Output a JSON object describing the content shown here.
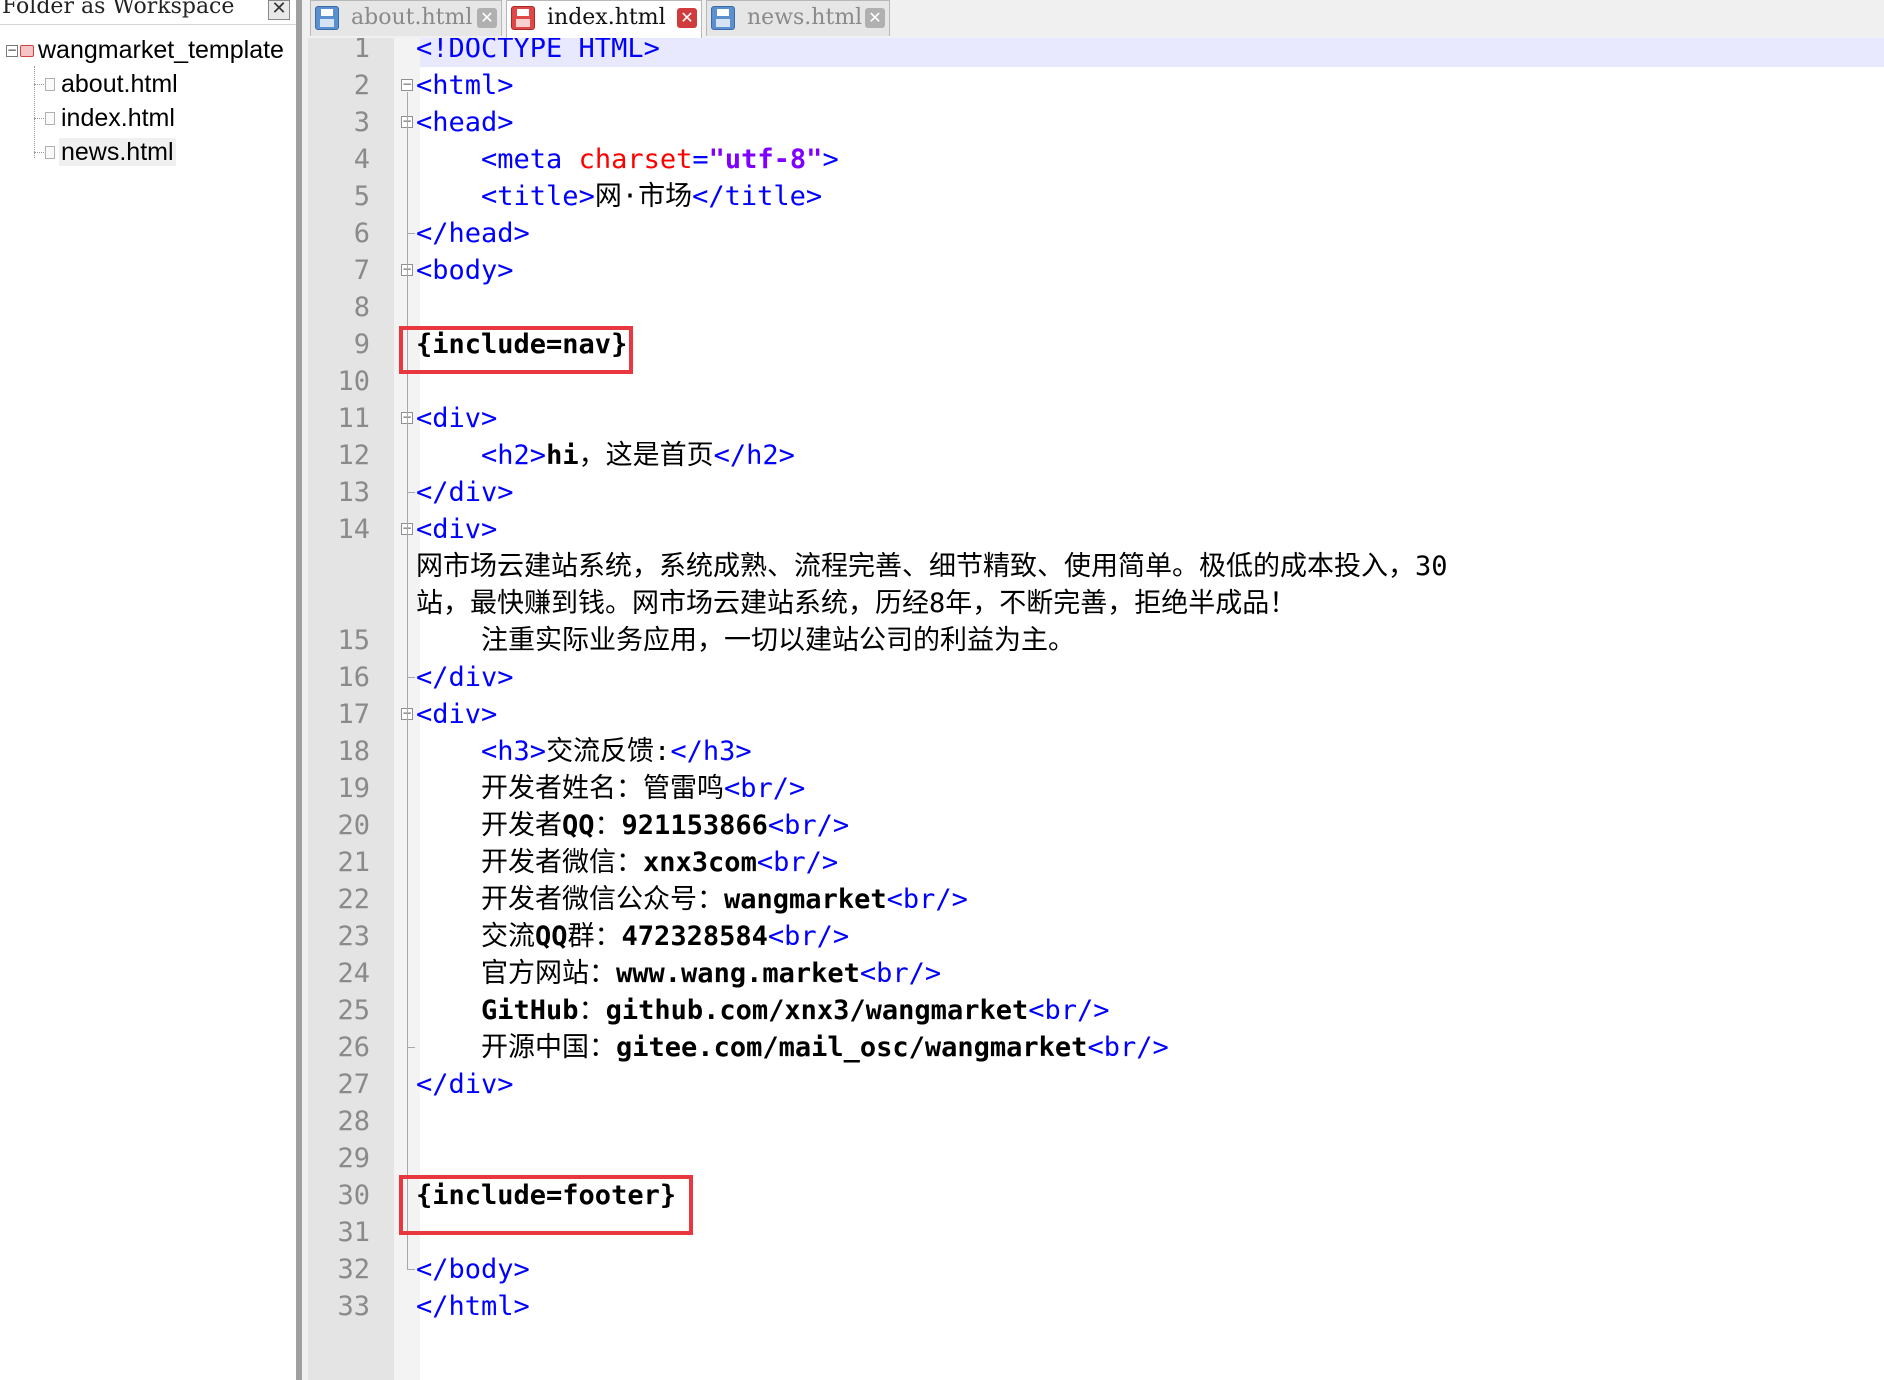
{
  "colors": {
    "tag": "#0000ff",
    "attribute": "#ff0000",
    "string": "#8000ff",
    "text": "#000000",
    "highlight_box": "#e8373f",
    "current_line": "#e8e8ff"
  },
  "sidebar": {
    "title": "Folder as Workspace",
    "close_icon": "close-icon",
    "root": {
      "label": "wangmarket_template",
      "toggle": "−"
    },
    "files": [
      {
        "label": "about.html"
      },
      {
        "label": "index.html"
      },
      {
        "label": "news.html",
        "selected": true
      }
    ]
  },
  "tabs": [
    {
      "label": "about.html",
      "icon": "save-icon-blue",
      "active": false
    },
    {
      "label": "index.html",
      "icon": "save-icon-red",
      "active": true
    },
    {
      "label": "news.html",
      "icon": "save-icon-blue",
      "active": false
    }
  ],
  "editor": {
    "lines": [
      {
        "n": "1",
        "tokens": [
          [
            "tag",
            "<!DOCTYPE HTML>"
          ]
        ]
      },
      {
        "n": "2",
        "fold": "open",
        "tokens": [
          [
            "tag",
            "<html>"
          ]
        ]
      },
      {
        "n": "3",
        "fold": "open",
        "tokens": [
          [
            "tag",
            "<head>"
          ]
        ]
      },
      {
        "n": "4",
        "tokens": [
          [
            "txt",
            "    "
          ],
          [
            "tag",
            "<meta "
          ],
          [
            "attr",
            "charset"
          ],
          [
            "tag",
            "="
          ],
          [
            "str",
            "\"utf-8\""
          ],
          [
            "tag",
            ">"
          ]
        ]
      },
      {
        "n": "5",
        "tokens": [
          [
            "txt",
            "    "
          ],
          [
            "tag",
            "<title>"
          ],
          [
            "txt",
            "网·市场"
          ],
          [
            "tag",
            "</title>"
          ]
        ]
      },
      {
        "n": "6",
        "tokens": [
          [
            "tag",
            "</head>"
          ]
        ]
      },
      {
        "n": "7",
        "fold": "open",
        "tokens": [
          [
            "tag",
            "<body>"
          ]
        ]
      },
      {
        "n": "8",
        "tokens": []
      },
      {
        "n": "9",
        "tokens": [
          [
            "bold",
            "{include=nav}"
          ]
        ]
      },
      {
        "n": "10",
        "tokens": []
      },
      {
        "n": "11",
        "fold": "open",
        "tokens": [
          [
            "tag",
            "<div>"
          ]
        ]
      },
      {
        "n": "12",
        "tokens": [
          [
            "txt",
            "    "
          ],
          [
            "tag",
            "<h2>"
          ],
          [
            "bold",
            "hi"
          ],
          [
            "txt",
            "，这是首页"
          ],
          [
            "tag",
            "</h2>"
          ]
        ]
      },
      {
        "n": "13",
        "tokens": [
          [
            "tag",
            "</div>"
          ]
        ]
      },
      {
        "n": "14",
        "fold": "open",
        "tokens": [
          [
            "tag",
            "<div>"
          ]
        ]
      },
      {
        "n": "",
        "tokens": [
          [
            "txt",
            "网市场云建站系统，系统成熟、流程完善、细节精致、使用简单。极低的成本投入，30"
          ]
        ]
      },
      {
        "n": "",
        "tokens": [
          [
            "txt",
            "站，最快赚到钱。网市场云建站系统，历经8年，不断完善，拒绝半成品！"
          ]
        ]
      },
      {
        "n": "15",
        "tokens": [
          [
            "txt",
            "    注重实际业务应用，一切以建站公司的利益为主。"
          ]
        ]
      },
      {
        "n": "16",
        "tokens": [
          [
            "tag",
            "</div>"
          ]
        ]
      },
      {
        "n": "17",
        "fold": "open",
        "tokens": [
          [
            "tag",
            "<div>"
          ]
        ]
      },
      {
        "n": "18",
        "tokens": [
          [
            "txt",
            "    "
          ],
          [
            "tag",
            "<h3>"
          ],
          [
            "txt",
            "交流反馈:"
          ],
          [
            "tag",
            "</h3>"
          ]
        ]
      },
      {
        "n": "19",
        "tokens": [
          [
            "txt",
            "    开发者姓名：管雷鸣"
          ],
          [
            "tag",
            "<br/>"
          ]
        ]
      },
      {
        "n": "20",
        "tokens": [
          [
            "txt",
            "    开发者"
          ],
          [
            "bold",
            "QQ"
          ],
          [
            "txt",
            "："
          ],
          [
            "bold",
            "921153866"
          ],
          [
            "tag",
            "<br/>"
          ]
        ]
      },
      {
        "n": "21",
        "tokens": [
          [
            "txt",
            "    开发者微信："
          ],
          [
            "bold",
            "xnx3com"
          ],
          [
            "tag",
            "<br/>"
          ]
        ]
      },
      {
        "n": "22",
        "tokens": [
          [
            "txt",
            "    开发者微信公众号："
          ],
          [
            "bold",
            "wangmarket"
          ],
          [
            "tag",
            "<br/>"
          ]
        ]
      },
      {
        "n": "23",
        "tokens": [
          [
            "txt",
            "    交流"
          ],
          [
            "bold",
            "QQ"
          ],
          [
            "txt",
            "群："
          ],
          [
            "bold",
            "472328584"
          ],
          [
            "tag",
            "<br/>"
          ]
        ]
      },
      {
        "n": "24",
        "tokens": [
          [
            "txt",
            "    官方网站："
          ],
          [
            "bold",
            "www.wang.market"
          ],
          [
            "tag",
            "<br/>"
          ]
        ]
      },
      {
        "n": "25",
        "tokens": [
          [
            "txt",
            "    "
          ],
          [
            "bold",
            "GitHub"
          ],
          [
            "txt",
            "："
          ],
          [
            "bold",
            "github.com/xnx3/wangmarket"
          ],
          [
            "tag",
            "<br/>"
          ]
        ]
      },
      {
        "n": "26",
        "tokens": [
          [
            "txt",
            "    开源中国："
          ],
          [
            "bold",
            "gitee.com/mail_osc/wangmarket"
          ],
          [
            "tag",
            "<br/>"
          ]
        ]
      },
      {
        "n": "27",
        "tokens": [
          [
            "tag",
            "</div>"
          ]
        ]
      },
      {
        "n": "28",
        "tokens": []
      },
      {
        "n": "29",
        "tokens": []
      },
      {
        "n": "30",
        "tokens": [
          [
            "bold",
            "{include=footer}"
          ]
        ]
      },
      {
        "n": "31",
        "tokens": []
      },
      {
        "n": "32",
        "tokens": [
          [
            "tag",
            "</body>"
          ]
        ]
      },
      {
        "n": "33",
        "tokens": [
          [
            "tag",
            "</html>"
          ]
        ]
      }
    ]
  }
}
